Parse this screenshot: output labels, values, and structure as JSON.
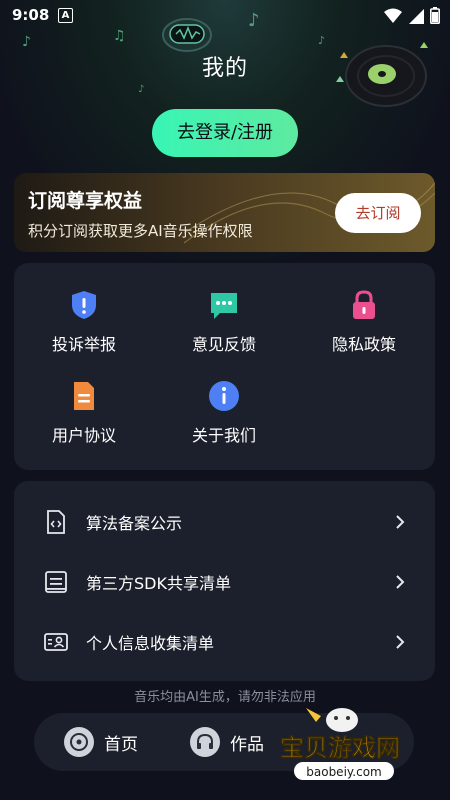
{
  "status": {
    "time": "9:08",
    "notif": "A"
  },
  "header": {
    "title": "我的",
    "login_label": "去登录/注册"
  },
  "vip": {
    "title": "订阅尊享权益",
    "subtitle": "积分订阅获取更多AI音乐操作权限",
    "button": "去订阅"
  },
  "grid": {
    "items": [
      {
        "label": "投诉举报",
        "icon": "shield-alert-icon"
      },
      {
        "label": "意见反馈",
        "icon": "chat-bubble-icon"
      },
      {
        "label": "隐私政策",
        "icon": "lock-icon"
      },
      {
        "label": "用户协议",
        "icon": "document-icon"
      },
      {
        "label": "关于我们",
        "icon": "info-icon"
      }
    ]
  },
  "list": {
    "items": [
      {
        "label": "算法备案公示",
        "icon": "code-file-icon"
      },
      {
        "label": "第三方SDK共享清单",
        "icon": "list-box-icon"
      },
      {
        "label": "个人信息收集清单",
        "icon": "id-card-icon"
      }
    ]
  },
  "footer": {
    "text": "音乐均由AI生成，请勿非法应用"
  },
  "nav": {
    "home": "首页",
    "works": "作品"
  },
  "watermark": {
    "text": "宝贝游戏网",
    "url": "baobeiy.com"
  },
  "colors": {
    "accent": "#38f5b5",
    "panel": "#1c202c",
    "background": "#0f121d"
  }
}
